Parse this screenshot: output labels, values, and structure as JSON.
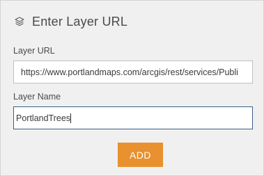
{
  "header": {
    "icon": "layers-icon",
    "title": "Enter Layer URL"
  },
  "layer_url": {
    "label": "Layer URL",
    "value": "https://www.portlandmaps.com/arcgis/rest/services/Publi"
  },
  "layer_name": {
    "label": "Layer Name",
    "value": "PortlandTrees"
  },
  "add_button": {
    "label": "ADD",
    "color": "#e8912e"
  }
}
